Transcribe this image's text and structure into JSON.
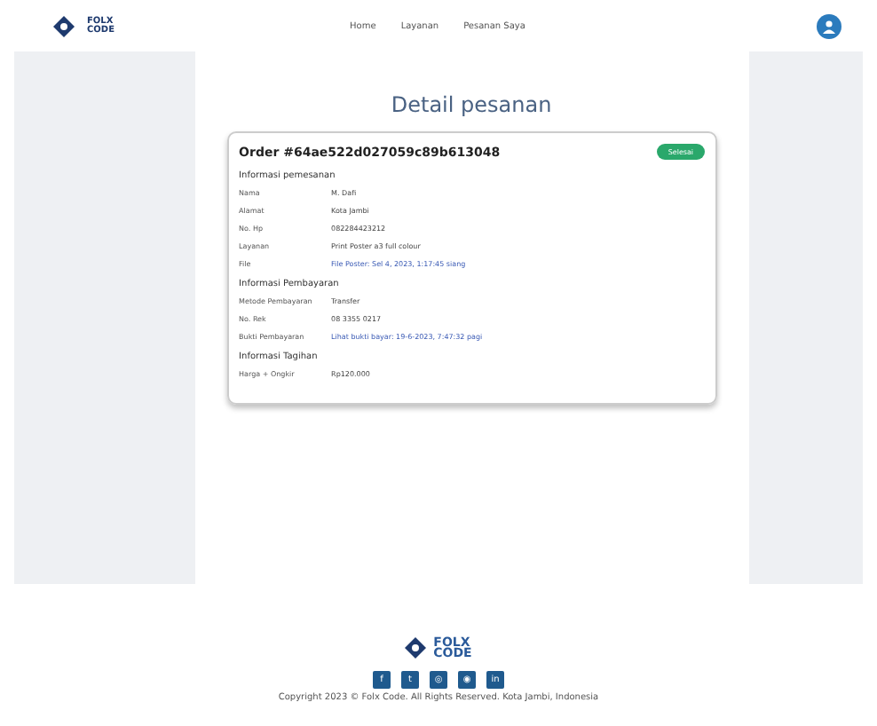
{
  "header": {
    "logo": "FOLX CODE",
    "nav": [
      "Home",
      "Layanan",
      "Pesanan Saya"
    ]
  },
  "title": "Detail pesanan",
  "order": {
    "title": "Order #64ae522d027059c89b613048",
    "status": "Selesai",
    "sections": [
      {
        "heading": "Informasi pemesanan",
        "rows": [
          {
            "label": "Nama",
            "value": "M. Dafi",
            "kind": "text"
          },
          {
            "label": "Alamat",
            "value": "Kota Jambi",
            "kind": "text"
          },
          {
            "label": "No. Hp",
            "value": "082284423212",
            "kind": "text"
          },
          {
            "label": "Layanan",
            "value": "Print Poster a3 full colour",
            "kind": "text"
          },
          {
            "label": "File",
            "value": "File Poster: Sel 4, 2023, 1:17:45 siang",
            "kind": "link"
          }
        ]
      },
      {
        "heading": "Informasi Pembayaran",
        "rows": [
          {
            "label": "Metode Pembayaran",
            "value": "Transfer",
            "kind": "text"
          },
          {
            "label": "No. Rek",
            "value": "08 3355 0217",
            "kind": "text"
          },
          {
            "label": "Bukti Pembayaran",
            "value": "Lihat bukti bayar: 19-6-2023, 7:47:32 pagi",
            "kind": "link"
          }
        ]
      },
      {
        "heading": "Informasi Tagihan",
        "rows": [
          {
            "label": "Harga + Ongkir",
            "value": "Rp120.000",
            "kind": "text"
          }
        ]
      }
    ]
  },
  "footer": {
    "logo": [
      "FOLX",
      "CODE"
    ],
    "social": [
      "f",
      "t",
      "◎",
      "◉",
      "in"
    ],
    "copyright": "Copyright 2023 © Folx Code. All Rights Reserved. Kota Jambi, Indonesia"
  }
}
